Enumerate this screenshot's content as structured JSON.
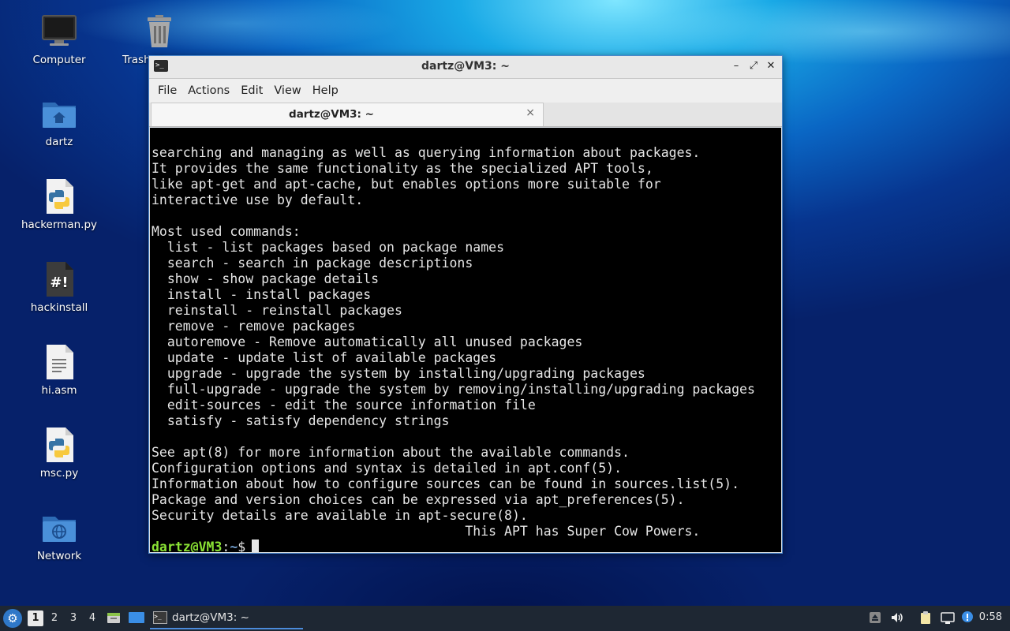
{
  "desktop": {
    "icons": [
      {
        "label": "Computer",
        "icon": "monitor-icon"
      },
      {
        "label": "Trash (Empty)",
        "icon": "trash-icon"
      },
      {
        "label": "dartz",
        "icon": "home-folder-icon"
      },
      {
        "label": "hackerman.py",
        "icon": "python-file-icon"
      },
      {
        "label": "hackinstall",
        "icon": "script-file-icon"
      },
      {
        "label": "hi.asm",
        "icon": "text-file-icon"
      },
      {
        "label": "msc.py",
        "icon": "python-file-icon"
      },
      {
        "label": "Network",
        "icon": "network-folder-icon"
      }
    ]
  },
  "window": {
    "title": "dartz@VM3: ~",
    "controls": {
      "minimize": "–",
      "maximize": "⤢",
      "close": "✕"
    },
    "menu": [
      "File",
      "Actions",
      "Edit",
      "View",
      "Help"
    ],
    "tab": {
      "label": "dartz@VM3: ~",
      "close": "×"
    }
  },
  "terminal": {
    "lines": [
      "searching and managing as well as querying information about packages.",
      "It provides the same functionality as the specialized APT tools,",
      "like apt-get and apt-cache, but enables options more suitable for",
      "interactive use by default.",
      "",
      "Most used commands:",
      "  list - list packages based on package names",
      "  search - search in package descriptions",
      "  show - show package details",
      "  install - install packages",
      "  reinstall - reinstall packages",
      "  remove - remove packages",
      "  autoremove - Remove automatically all unused packages",
      "  update - update list of available packages",
      "  upgrade - upgrade the system by installing/upgrading packages",
      "  full-upgrade - upgrade the system by removing/installing/upgrading packages",
      "  edit-sources - edit the source information file",
      "  satisfy - satisfy dependency strings",
      "",
      "See apt(8) for more information about the available commands.",
      "Configuration options and syntax is detailed in apt.conf(5).",
      "Information about how to configure sources can be found in sources.list(5).",
      "Package and version choices can be expressed via apt_preferences(5).",
      "Security details are available in apt-secure(8).",
      "                                        This APT has Super Cow Powers."
    ],
    "prompt": {
      "user_host": "dartz@VM3",
      "separator": ":",
      "path": "~",
      "symbol": "$"
    }
  },
  "taskbar": {
    "workspaces": [
      "1",
      "2",
      "3",
      "4"
    ],
    "active_workspace": "1",
    "task_label": "dartz@VM3: ~",
    "clock": "0:58"
  },
  "colors": {
    "prompt_user": "#8ae234",
    "prompt_path": "#729fcf",
    "window_border": "#4b86c9",
    "taskbar_bg": "#1e2733"
  }
}
